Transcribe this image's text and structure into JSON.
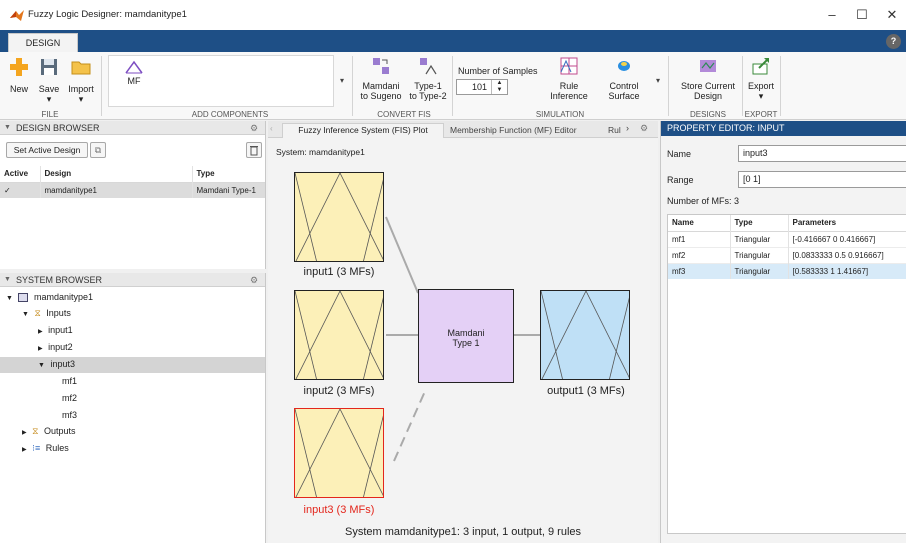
{
  "window": {
    "title": "Fuzzy Logic Designer: mamdanitype1",
    "minimize": "–",
    "maximize": "☐",
    "close": "✕"
  },
  "tabs": {
    "design": "DESIGN",
    "help": "?"
  },
  "ribbon": {
    "file": {
      "new": "New",
      "save": "Save",
      "import": "Import",
      "label": "FILE"
    },
    "add_components": {
      "mf": "MF",
      "label": "ADD COMPONENTS"
    },
    "convert_fis": {
      "mamdani_l1": "Mamdani",
      "mamdani_l2": "to Sugeno",
      "type1_l1": "Type-1",
      "type1_l2": "to Type-2",
      "label": "CONVERT FIS"
    },
    "simulation": {
      "samples_label": "Number of Samples",
      "samples_value": "101",
      "rule_l1": "Rule",
      "rule_l2": "Inference",
      "control_l1": "Control",
      "control_l2": "Surface",
      "label": "SIMULATION"
    },
    "designs": {
      "store_l1": "Store Current",
      "store_l2": "Design",
      "label": "DESIGNS"
    },
    "export": {
      "export": "Export",
      "label": "EXPORT"
    }
  },
  "design_browser": {
    "header": "DESIGN BROWSER",
    "set_active": "Set Active Design",
    "columns": [
      "Active",
      "Design",
      "Type"
    ],
    "rows": [
      {
        "active": "✓",
        "design": "mamdanitype1",
        "type": "Mamdani Type-1"
      }
    ]
  },
  "system_browser": {
    "header": "SYSTEM BROWSER",
    "root": "mamdanitype1",
    "inputs": "Inputs",
    "input1": "input1",
    "input2": "input2",
    "input3": "input3",
    "mf1": "mf1",
    "mf2": "mf2",
    "mf3": "mf3",
    "outputs": "Outputs",
    "rules": "Rules"
  },
  "center": {
    "tab_fis": "Fuzzy Inference System (FIS) Plot",
    "tab_mf": "Membership Function (MF) Editor",
    "tab_rule": "Rul",
    "system_label": "System: mamdanitype1",
    "input1": "input1 (3 MFs)",
    "input2": "input2 (3 MFs)",
    "input3": "input3 (3 MFs)",
    "output1": "output1 (3 MFs)",
    "mamdani_l1": "Mamdani",
    "mamdani_l2": "Type 1",
    "summary": "System mamdanitype1: 3 input, 1 output, 9 rules"
  },
  "property_editor": {
    "header": "PROPERTY EDITOR: INPUT",
    "name_label": "Name",
    "name_value": "input3",
    "range_label": "Range",
    "range_value": "[0 1]",
    "num_mfs": "Number of MFs:  3",
    "columns": [
      "Name",
      "Type",
      "Parameters"
    ],
    "rows": [
      {
        "name": "mf1",
        "type": "Triangular",
        "params": "[-0.416667 0 0.416667]"
      },
      {
        "name": "mf2",
        "type": "Triangular",
        "params": "[0.0833333 0.5 0.916667]"
      },
      {
        "name": "mf3",
        "type": "Triangular",
        "params": "[0.583333 1 1.41667]"
      }
    ]
  },
  "colors": {
    "title_blue": "#1e4f86",
    "input_fill": "#fcf0b8",
    "output_fill": "#bfe0f6",
    "mamdani_fill": "#e4d0f6",
    "selected_border": "#e3261c"
  }
}
